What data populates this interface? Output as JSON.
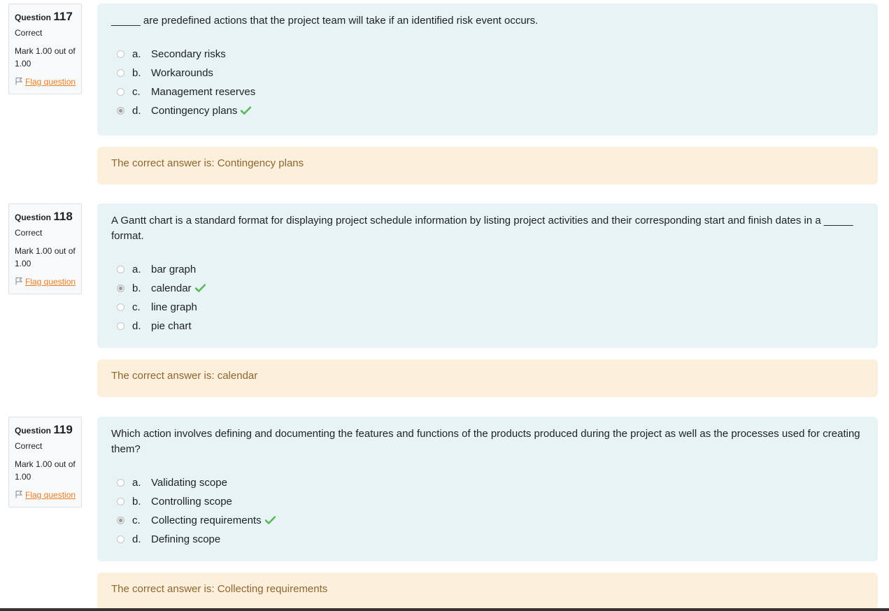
{
  "questions": [
    {
      "label": "Question",
      "number": "117",
      "state": "Correct",
      "grade": "Mark 1.00 out of 1.00",
      "flag_label": "Flag question",
      "text": "_____ are predefined actions that the project team will take if an identified risk event occurs.",
      "answers": [
        {
          "letter": "a.",
          "text": "Secondary risks",
          "selected": false,
          "correct": false
        },
        {
          "letter": "b.",
          "text": "Workarounds",
          "selected": false,
          "correct": false
        },
        {
          "letter": "c.",
          "text": "Management reserves",
          "selected": false,
          "correct": false
        },
        {
          "letter": "d.",
          "text": "Contingency plans",
          "selected": true,
          "correct": true
        }
      ],
      "feedback": "The correct answer is: Contingency plans"
    },
    {
      "label": "Question",
      "number": "118",
      "state": "Correct",
      "grade": "Mark 1.00 out of 1.00",
      "flag_label": "Flag question",
      "text": "A Gantt chart is a standard format for displaying project schedule information by listing project activities and their corresponding start and finish dates in a _____ format.",
      "answers": [
        {
          "letter": "a.",
          "text": "bar graph",
          "selected": false,
          "correct": false
        },
        {
          "letter": "b.",
          "text": "calendar",
          "selected": true,
          "correct": true
        },
        {
          "letter": "c.",
          "text": "line graph",
          "selected": false,
          "correct": false
        },
        {
          "letter": "d.",
          "text": "pie chart",
          "selected": false,
          "correct": false
        }
      ],
      "feedback": "The correct answer is: calendar"
    },
    {
      "label": "Question",
      "number": "119",
      "state": "Correct",
      "grade": "Mark 1.00 out of 1.00",
      "flag_label": "Flag question",
      "text": "Which action involves defining and documenting the features and functions of the products produced during the project as well as the processes used for creating them?",
      "answers": [
        {
          "letter": "a.",
          "text": "Validating scope",
          "selected": false,
          "correct": false
        },
        {
          "letter": "b.",
          "text": "Controlling scope",
          "selected": false,
          "correct": false
        },
        {
          "letter": "c.",
          "text": "Collecting requirements",
          "selected": true,
          "correct": true
        },
        {
          "letter": "d.",
          "text": "Defining scope",
          "selected": false,
          "correct": false
        }
      ],
      "feedback": "The correct answer is: Collecting requirements"
    }
  ],
  "colors": {
    "formulation_bg": "#e7f3f5",
    "feedback_bg": "#fcefdc",
    "feedback_text": "#8e662e",
    "flag_link": "#e67e22",
    "check": "#5cb85c"
  },
  "icons": {
    "flag": "flag-outline-icon",
    "correct": "checkmark-icon"
  }
}
